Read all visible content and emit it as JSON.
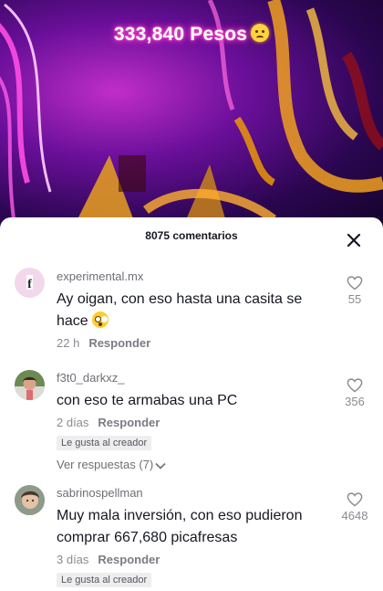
{
  "video": {
    "overlay_text": "333,840 Pesos",
    "overlay_emoji": "crying-face-emoji"
  },
  "sheet": {
    "comment_count": "8075 comentarios",
    "close_icon": "close-icon"
  },
  "comments": [
    {
      "username": "experimental.mx",
      "text": "Ay oigan, con eso hasta una casita se hace",
      "emoji": "flushed-face-emoji",
      "time": "22 h",
      "reply_label": "Responder",
      "likes": "55",
      "avatar": "letter-f-avatar"
    },
    {
      "username": "f3t0_darkxz_",
      "text": "con eso te armabas una PC",
      "time": "2 días",
      "reply_label": "Responder",
      "badge": "Le gusta al creador",
      "view_replies": "Ver respuestas (7)",
      "likes": "356",
      "avatar": "person-avatar"
    },
    {
      "username": "sabrinospellman",
      "text": "Muy mala inversión, con eso pudieron comprar 667,680 picafresas",
      "time": "3 días",
      "reply_label": "Responder",
      "badge": "Le gusta al creador",
      "likes": "4648",
      "avatar": "person-avatar"
    }
  ],
  "colors": {
    "primary_text": "#161823",
    "secondary_text": "#8a8b91",
    "badge_bg": "#eeeeef",
    "neon_pink": "#ff4dd2"
  }
}
